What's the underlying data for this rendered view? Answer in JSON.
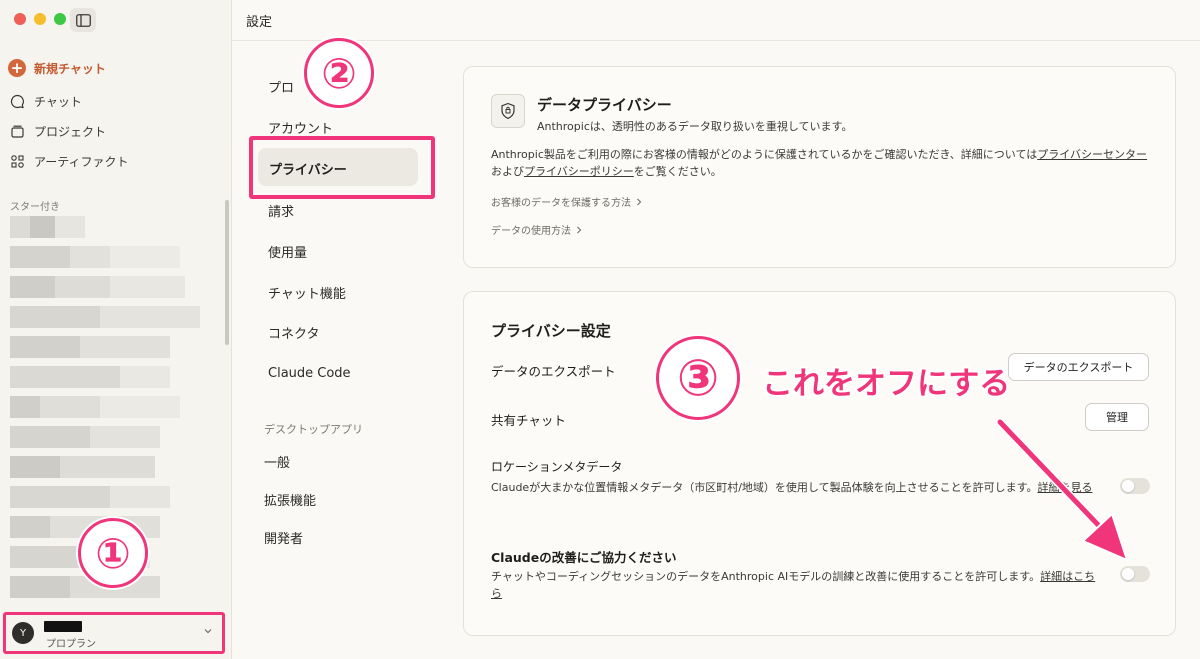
{
  "sidebar": {
    "new_chat": "新規チャット",
    "chat": "チャット",
    "projects": "プロジェクト",
    "artifacts": "アーティファクト",
    "starred_label": "スター付き",
    "user_initial": "Y",
    "user_plan": "プロプラン"
  },
  "header": {
    "title": "設定"
  },
  "menu": {
    "profile": "プロ",
    "account": "アカウント",
    "privacy": "プライバシー",
    "billing": "請求",
    "usage": "使用量",
    "chat_features": "チャット機能",
    "connectors": "コネクタ",
    "claude_code": "Claude Code",
    "desktop_app_label": "デスクトップアプリ",
    "general": "一般",
    "extensions": "拡張機能",
    "developer": "開発者"
  },
  "privacy_card": {
    "title": "データプライバシー",
    "subtitle": "Anthropicは、透明性のあるデータ取り扱いを重視しています。",
    "body_pre": "Anthropic製品をご利用の際にお客様の情報がどのように保護されているかをご確認いただき、詳細については",
    "link_center": "プライバシーセンター",
    "body_mid": "および",
    "link_policy": "プライバシーポリシー",
    "body_post": "をご覧ください。",
    "link_protect": "お客様のデータを保護する方法",
    "link_usage": "データの使用方法"
  },
  "settings_card": {
    "title": "プライバシー設定",
    "export_label": "データのエクスポート",
    "export_button": "データのエクスポート",
    "shared_label": "共有チャット",
    "manage_button": "管理",
    "location_label": "ロケーションメタデータ",
    "location_desc": "Claudeが大まかな位置情報メタデータ（市区町村/地域）を使用して製品体験を向上させることを許可します。",
    "location_link": "詳細を見る",
    "location_enabled": false,
    "improve_label": "Claudeの改善にご協力ください",
    "improve_desc": "チャットやコーディングセッションのデータをAnthropic AIモデルの訓練と改善に使用することを許可します。",
    "improve_link": "詳細はこちら",
    "improve_enabled": false
  },
  "annotations": {
    "step1": "①",
    "step2": "②",
    "step3": "③",
    "instruction": "これをオフにする",
    "color": "#f0357a"
  }
}
